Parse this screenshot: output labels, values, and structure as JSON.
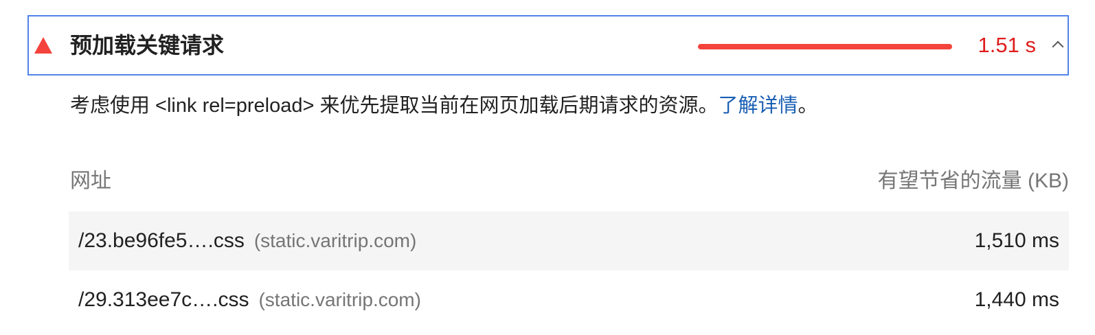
{
  "audit": {
    "status_icon": "warning-triangle-icon",
    "status_color": "#f4433c",
    "title": "预加载关键请求",
    "metric_value": "1.51 s",
    "metric_color": "#df1c1c",
    "metric_bar_fraction": 1.0,
    "expand_icon": "chevron-up-icon"
  },
  "description": {
    "text": "考虑使用 <link rel=preload> 来优先提取当前在网页加载后期请求的资源。",
    "link_label": "了解详情",
    "trailing": "。",
    "link_color": "#1a5fb4"
  },
  "table": {
    "columns": [
      "网址",
      "有望节省的流量 (KB)"
    ],
    "rows": [
      {
        "url": "/23.be96fe5….css",
        "host": "(static.varitrip.com)",
        "value": "1,510 ms"
      },
      {
        "url": "/29.313ee7c….css",
        "host": "(static.varitrip.com)",
        "value": "1,440 ms"
      }
    ]
  }
}
